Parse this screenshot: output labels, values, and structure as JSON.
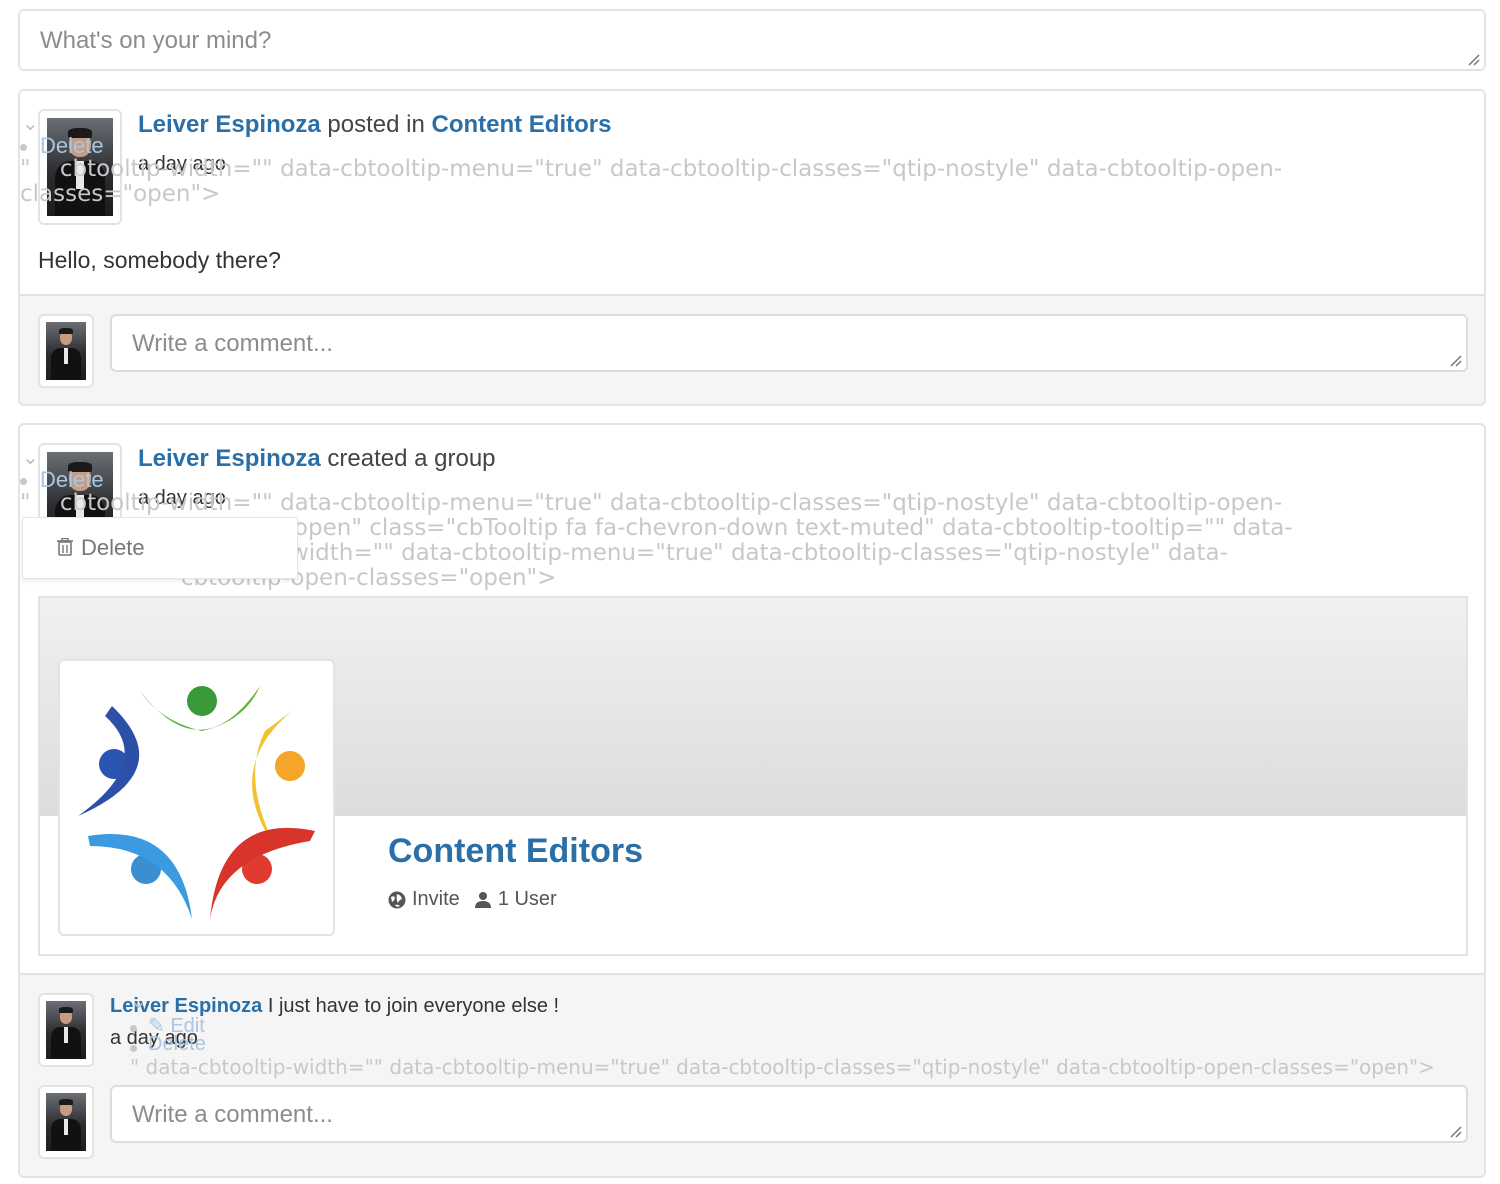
{
  "composer": {
    "placeholder": "What's on your mind?"
  },
  "posts": [
    {
      "author": "Leiver Espinoza",
      "action": "posted in",
      "target": "Content Editors",
      "time": "a day ago",
      "body": "Hello, somebody there?",
      "menu_faded_label": "Delete",
      "garbage_text": "\"    cbtooltip-width=\"\" data-cbtooltip-menu=\"true\" data-cbtooltip-classes=\"qtip-nostyle\" data-cbtooltip-open-\nclasses=\"open\">",
      "comment_placeholder": "Write a comment..."
    },
    {
      "author": "Leiver Espinoza",
      "action": "created a group",
      "time": "a day ago",
      "menu_faded_label": "Delete",
      "garbage_text": "\"    cbtooltip-width=\"\" data-cbtooltip-menu=\"true\" data-cbtooltip-classes=\"qtip-nostyle\" data-cbtooltip-open-\n                      classes=\"open\" class=\"cbTooltip fa fa-chevron-down text-muted\" data-cbtooltip-tooltip=\"\" data-\n                      cbtooltip-width=\"\" data-cbtooltip-menu=\"true\" data-cbtooltip-classes=\"qtip-nostyle\" data-\n                      cbtooltip-open-classes=\"open\">",
      "dropdown_label": "Delete",
      "group": {
        "name": "Content Editors",
        "invite_label": "Invite",
        "users_label": "1 User"
      },
      "reply": {
        "author": "Leiver Espinoza",
        "text": " I just have to join everyone else !",
        "time": "a day ago",
        "edit_label": "Edit",
        "delete_label": "Delete",
        "garbage_text": "\" data-cbtooltip-width=\"\" data-cbtooltip-menu=\"true\" data-cbtooltip-classes=\"qtip-nostyle\" data-cbtooltip-open-classes=\"open\">"
      },
      "comment_placeholder": "Write a comment..."
    }
  ],
  "colors": {
    "link": "#2a6fa8",
    "border": "#e3e3e3",
    "muted_bg": "#f5f5f5"
  }
}
